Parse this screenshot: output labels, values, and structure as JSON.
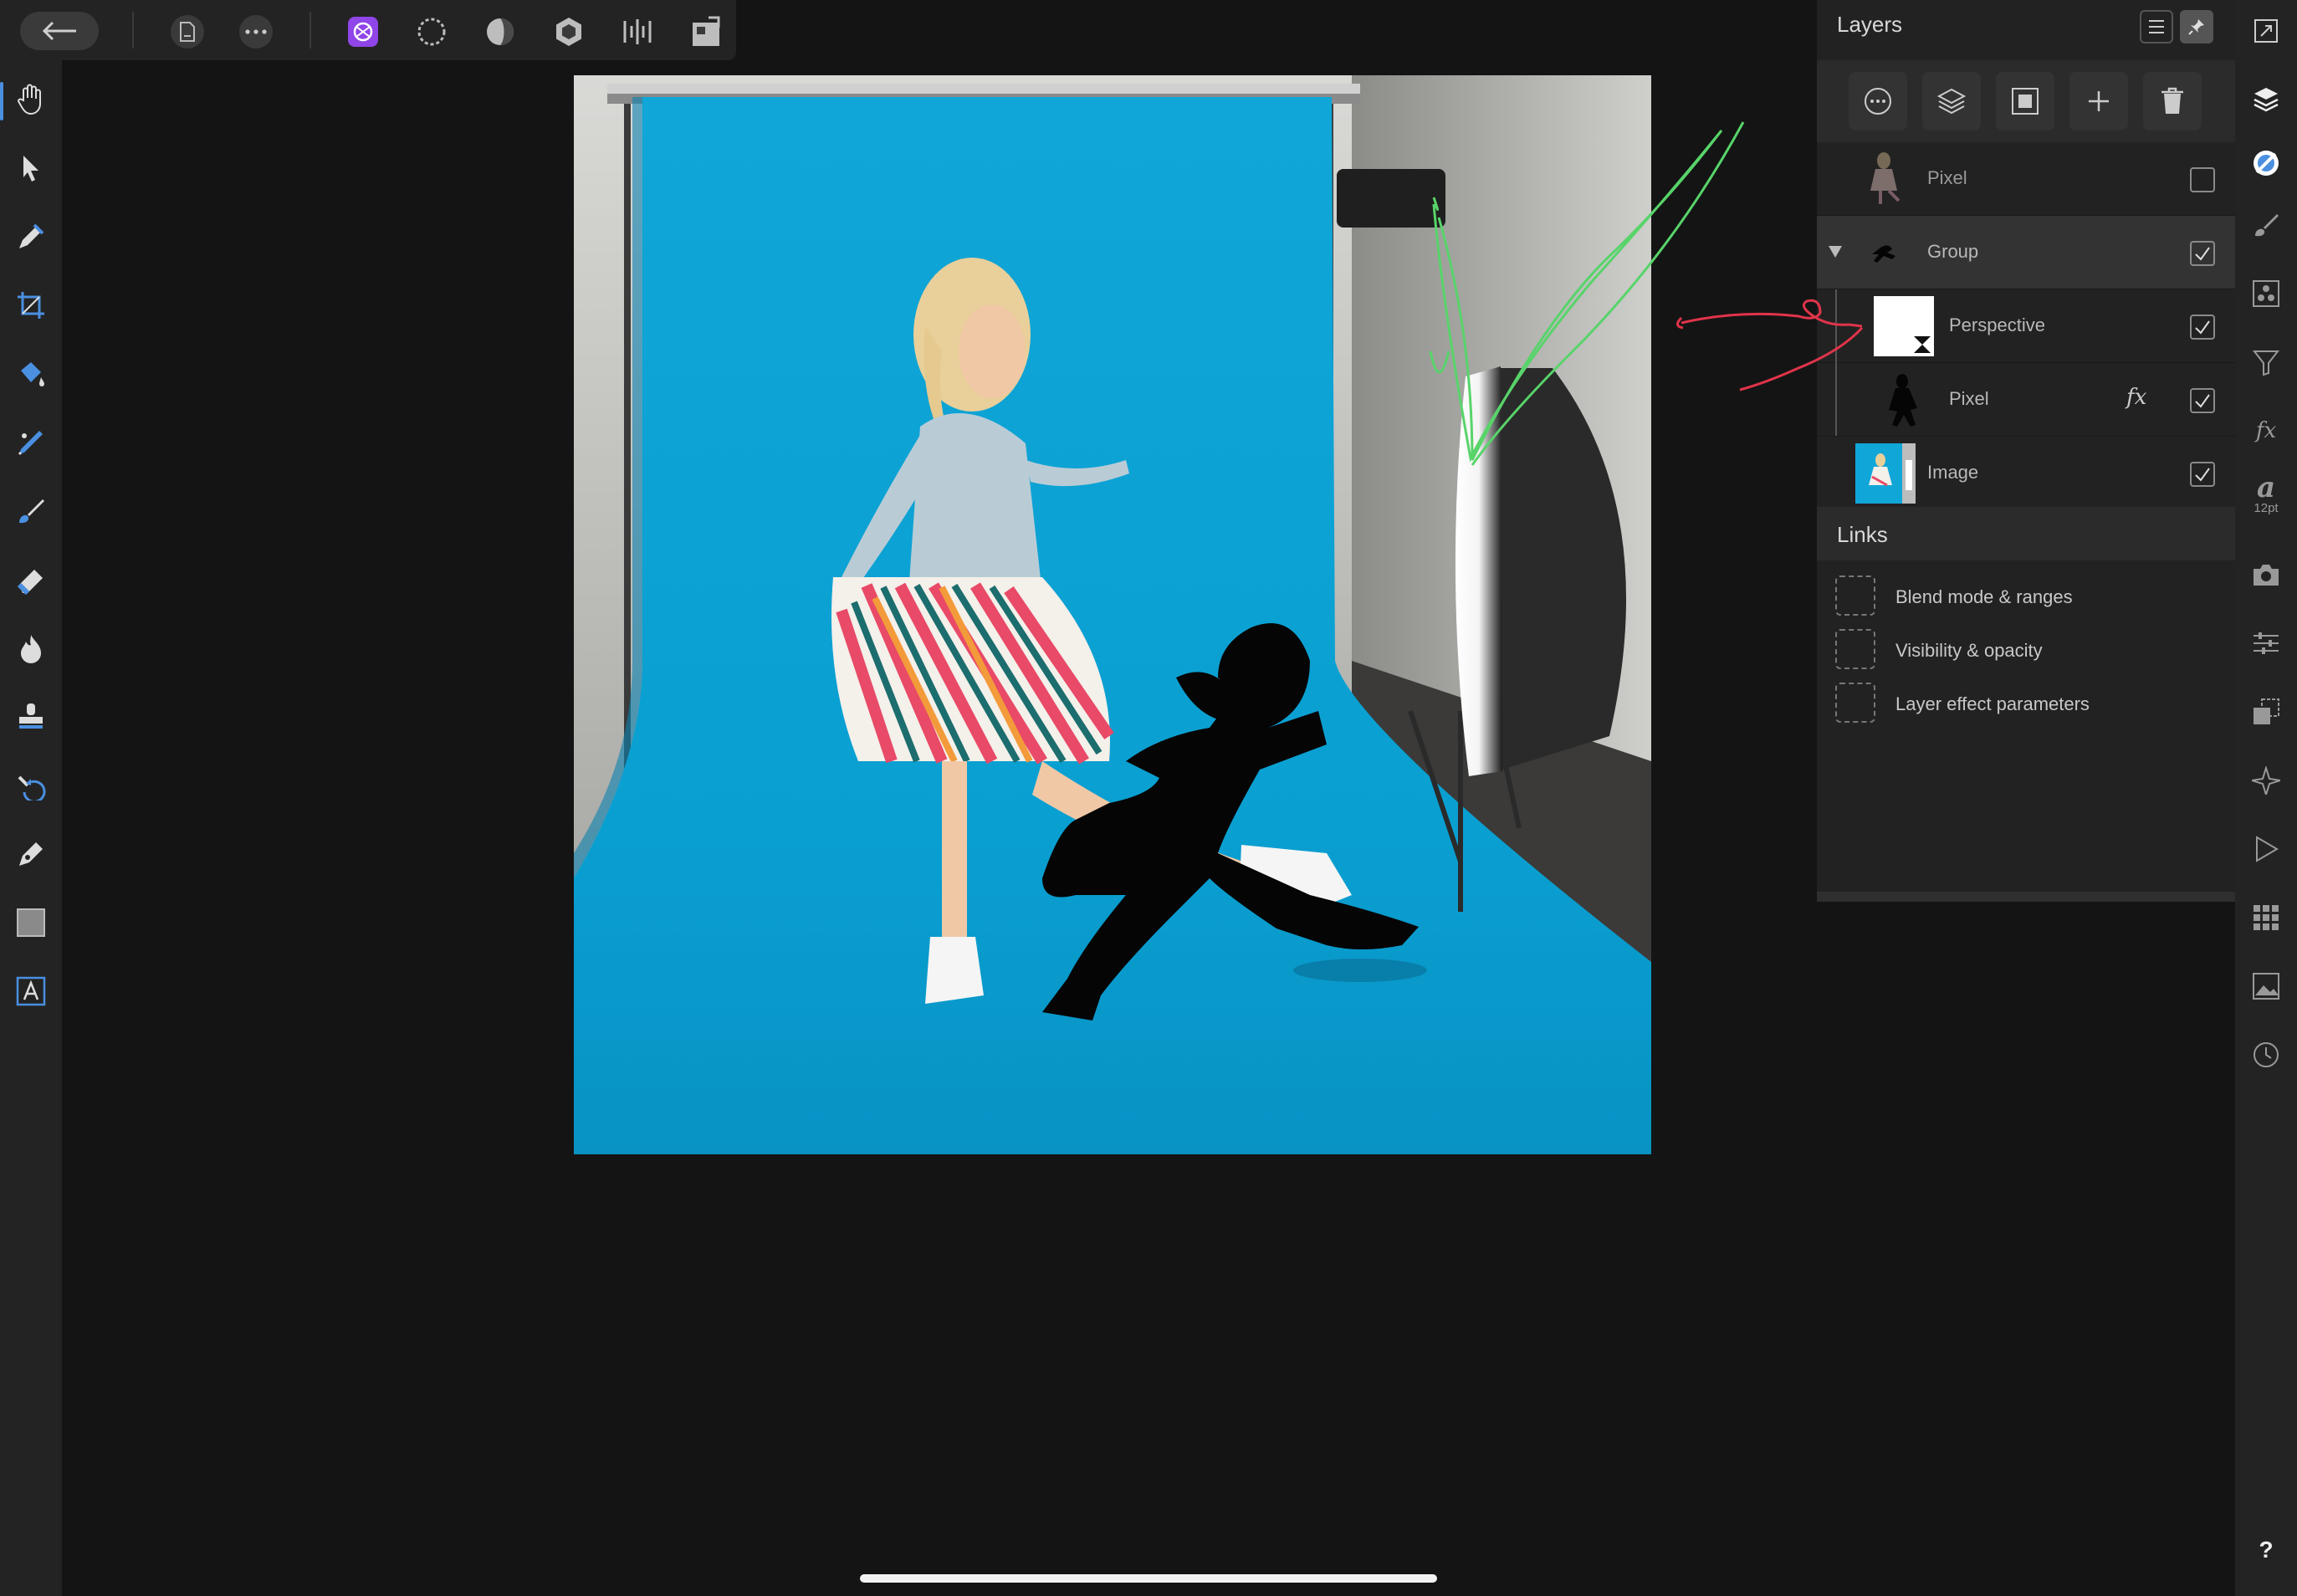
{
  "toolbar": {
    "icons": [
      "back-arrow-icon",
      "document-icon",
      "more-icon",
      "photo-persona-icon",
      "liquify-persona-icon",
      "develop-persona-icon",
      "tone-mapping-persona-icon",
      "export-persona-icon",
      "macro-icon"
    ]
  },
  "left_tools": [
    "hand-icon",
    "move-icon",
    "color-picker-icon",
    "crop-icon",
    "flood-fill-icon",
    "selection-brush-icon",
    "paint-brush-icon",
    "erase-brush-icon",
    "dodge-burn-icon",
    "clone-stamp-icon",
    "retouch-icon",
    "pen-icon",
    "rectangle-icon",
    "text-icon"
  ],
  "layers_panel": {
    "title": "Layers",
    "layers": [
      {
        "name": "Pixel",
        "visible": false
      },
      {
        "name": "Group",
        "visible": true
      },
      {
        "name": "Perspective",
        "visible": true
      },
      {
        "name": "Pixel",
        "visible": true,
        "fx": "fx"
      },
      {
        "name": "Image",
        "visible": true
      }
    ]
  },
  "links": {
    "title": "Links",
    "items": [
      "Blend mode & ranges",
      "Visibility & opacity",
      "Layer effect parameters"
    ]
  },
  "right_tools": {
    "text_size": "12pt",
    "help": "?"
  },
  "colors": {
    "backdrop_blue": "#079dcc",
    "active_persona": "#8f45e8",
    "annotation_green": "#58d46a",
    "annotation_red": "#e0344a"
  }
}
